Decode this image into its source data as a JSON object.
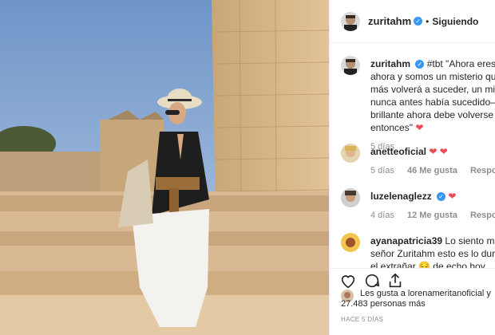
{
  "post": {
    "author": "zuritahm",
    "dot": "•",
    "follow_label": "Siguiendo"
  },
  "caption": {
    "author": "zuritahm",
    "line1": "#tbt \"Ahora eres y so",
    "line2": "ahora y somos un misterio que nu",
    "line3": "más volverá a suceder, un milagro",
    "line4": "nunca antes había sucedido— y e",
    "line5": "brillante ahora debe volverse",
    "line6": "entonces\"",
    "age": "5 días"
  },
  "comments": [
    {
      "user": "anetteoficial",
      "age": "5 días",
      "likes": "46 Me gusta",
      "reply": "Responder"
    },
    {
      "user": "luzelenaglezz",
      "age": "4 días",
      "likes": "12 Me gusta",
      "reply": "Responder"
    },
    {
      "user": "ayanapatricia39",
      "line1": "Lo siento mucho",
      "line2": "señor Zuritahm esto es lo duro",
      "line3": "el extrañar 😔 de echo hoy"
    }
  ],
  "likes": {
    "line1": "Les gusta a lorenameritanoficial y",
    "line2": "27.483 personas más"
  },
  "time_ago": "HACE 5 DÍAS",
  "icons": {
    "heart": "heart-icon",
    "comment": "comment-icon",
    "share": "share-icon",
    "verified": "verified-badge-icon",
    "emoji_heart": "red-heart-emoji"
  },
  "colors": {
    "verified": "#3897f0",
    "heart": "#ed4956",
    "muted": "#8e8e8e",
    "text": "#262626"
  }
}
